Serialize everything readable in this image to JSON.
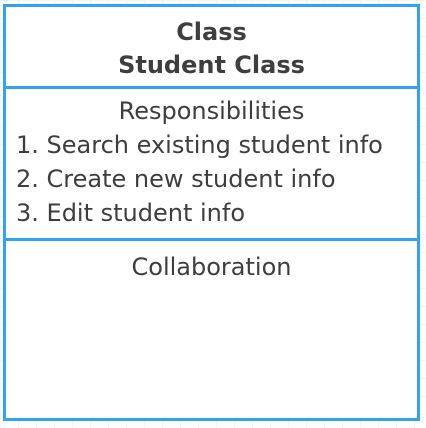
{
  "card": {
    "header": {
      "line1": "Class",
      "line2": "Student Class"
    },
    "responsibilities": {
      "title": "Responsibilities",
      "items": [
        "1. Search existing student info",
        "2. Create new student info",
        "3. Edit student info"
      ]
    },
    "collaboration": {
      "title": "Collaboration"
    }
  },
  "colors": {
    "border": "#33a2ef",
    "text": "#3e3e3e",
    "grid": "#f2f4f6"
  }
}
